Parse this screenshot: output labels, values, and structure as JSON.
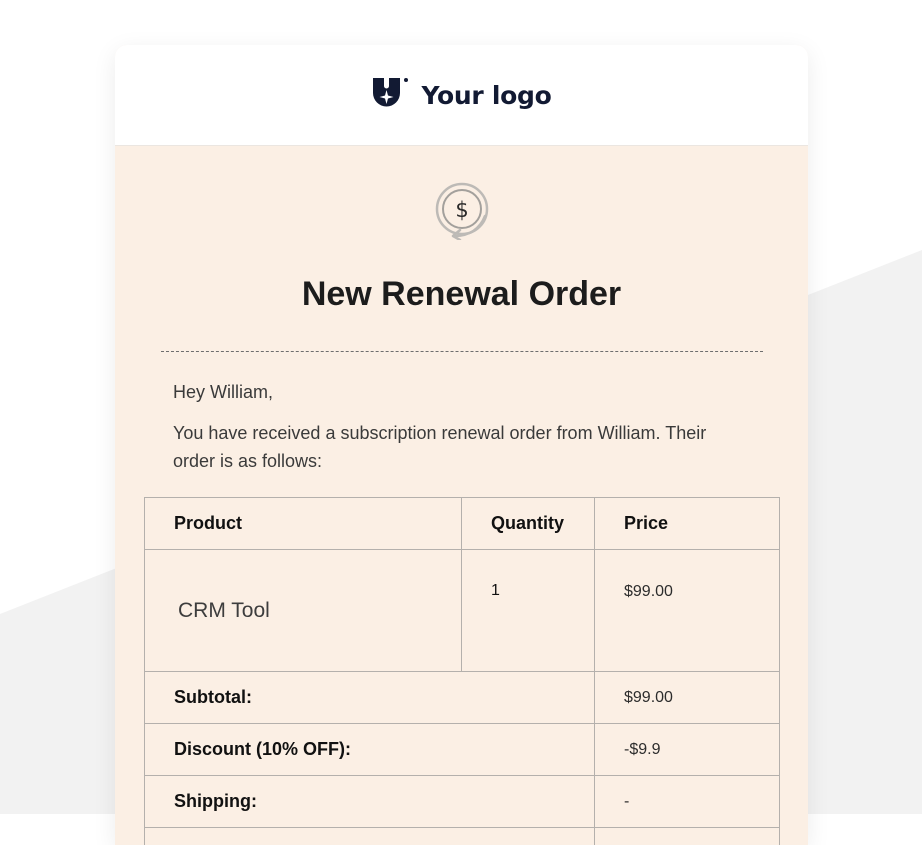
{
  "header": {
    "logo_text": "Your logo",
    "logo_icon": "shield-star-icon"
  },
  "hero": {
    "icon": "dollar-renew-icon",
    "icon_symbol": "$",
    "title": "New Renewal Order"
  },
  "message": {
    "greeting": "Hey William,",
    "intro": "You have received a subscription renewal order from William. Their order is as follows:"
  },
  "table": {
    "headers": {
      "product": "Product",
      "quantity": "Quantity",
      "price": "Price"
    },
    "items": [
      {
        "product": "CRM Tool",
        "quantity": "1",
        "price": "$99.00"
      }
    ],
    "summary": [
      {
        "label": "Subtotal:",
        "value": "$99.00"
      },
      {
        "label": "Discount (10% OFF):",
        "value": "-$9.9"
      },
      {
        "label": "Shipping:",
        "value": "-"
      },
      {
        "label": "",
        "value": ""
      }
    ]
  },
  "colors": {
    "card_background": "#fbefe4",
    "logo_navy": "#121a33",
    "table_border": "#b4b0ac",
    "page_shape": "#f2f2f2"
  }
}
